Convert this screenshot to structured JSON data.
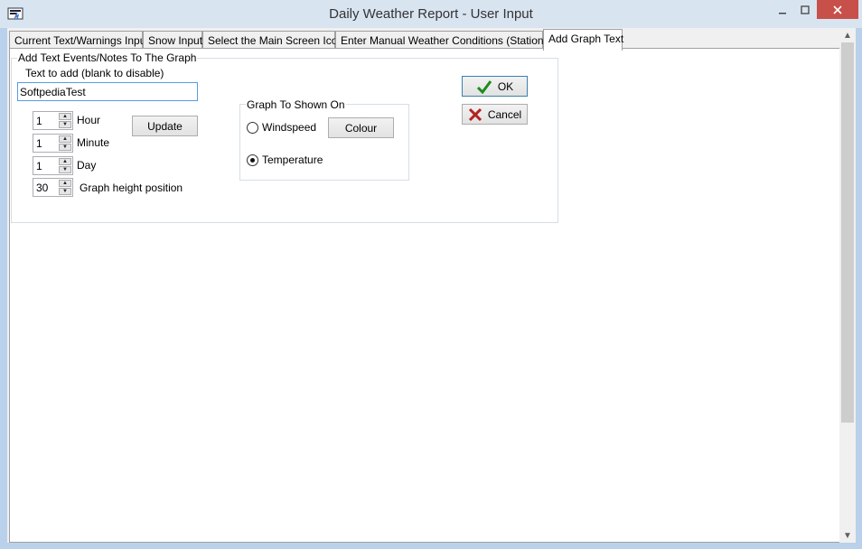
{
  "window": {
    "title": "Daily Weather Report - User Input"
  },
  "tabs": [
    {
      "label": "Current Text/Warnings Input"
    },
    {
      "label": "Snow Input"
    },
    {
      "label": "Select the Main Screen Icon"
    },
    {
      "label": "Enter Manual Weather Conditions (Stationless)"
    },
    {
      "label": "Add Graph Text",
      "active": true
    }
  ],
  "events_group": {
    "legend": "Add Text Events/Notes To The Graph",
    "text_label": "Text to add (blank to disable)",
    "text_value": "SoftpediaTest",
    "hour": {
      "value": "1",
      "label": "Hour"
    },
    "minute": {
      "value": "1",
      "label": "Minute"
    },
    "day": {
      "value": "1",
      "label": "Day"
    },
    "height": {
      "value": "30",
      "label": "Graph height position"
    },
    "update_label": "Update"
  },
  "graph_group": {
    "legend": "Graph To Shown On",
    "windspeed_label": "Windspeed",
    "temperature_label": "Temperature",
    "selected": "Temperature",
    "colour_label": "Colour"
  },
  "dialog": {
    "ok_label": "OK",
    "cancel_label": "Cancel"
  },
  "colors": {
    "ok_check": "#1e8a1e",
    "cancel_x": "#b22222",
    "accent": "#569de5"
  }
}
